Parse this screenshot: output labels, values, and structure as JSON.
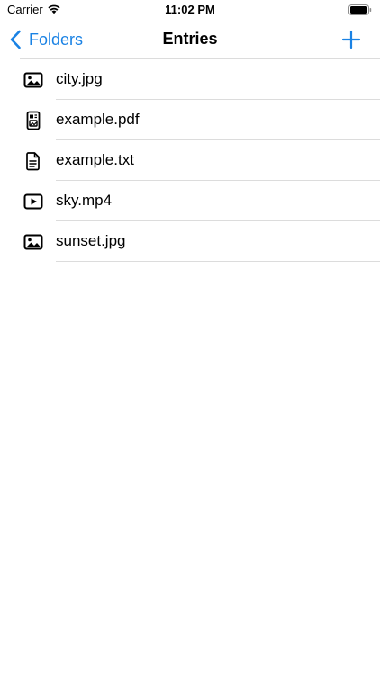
{
  "status_bar": {
    "carrier": "Carrier",
    "time": "11:02 PM"
  },
  "nav": {
    "back_label": "Folders",
    "title": "Entries"
  },
  "colors": {
    "accent": "#1a82e4",
    "separator": "#dcdcdc"
  },
  "entries": [
    {
      "label": "city.jpg",
      "icon": "photo-icon"
    },
    {
      "label": "example.pdf",
      "icon": "pdf-document-icon"
    },
    {
      "label": "example.txt",
      "icon": "text-document-icon"
    },
    {
      "label": "sky.mp4",
      "icon": "video-icon"
    },
    {
      "label": "sunset.jpg",
      "icon": "photo-icon"
    }
  ]
}
